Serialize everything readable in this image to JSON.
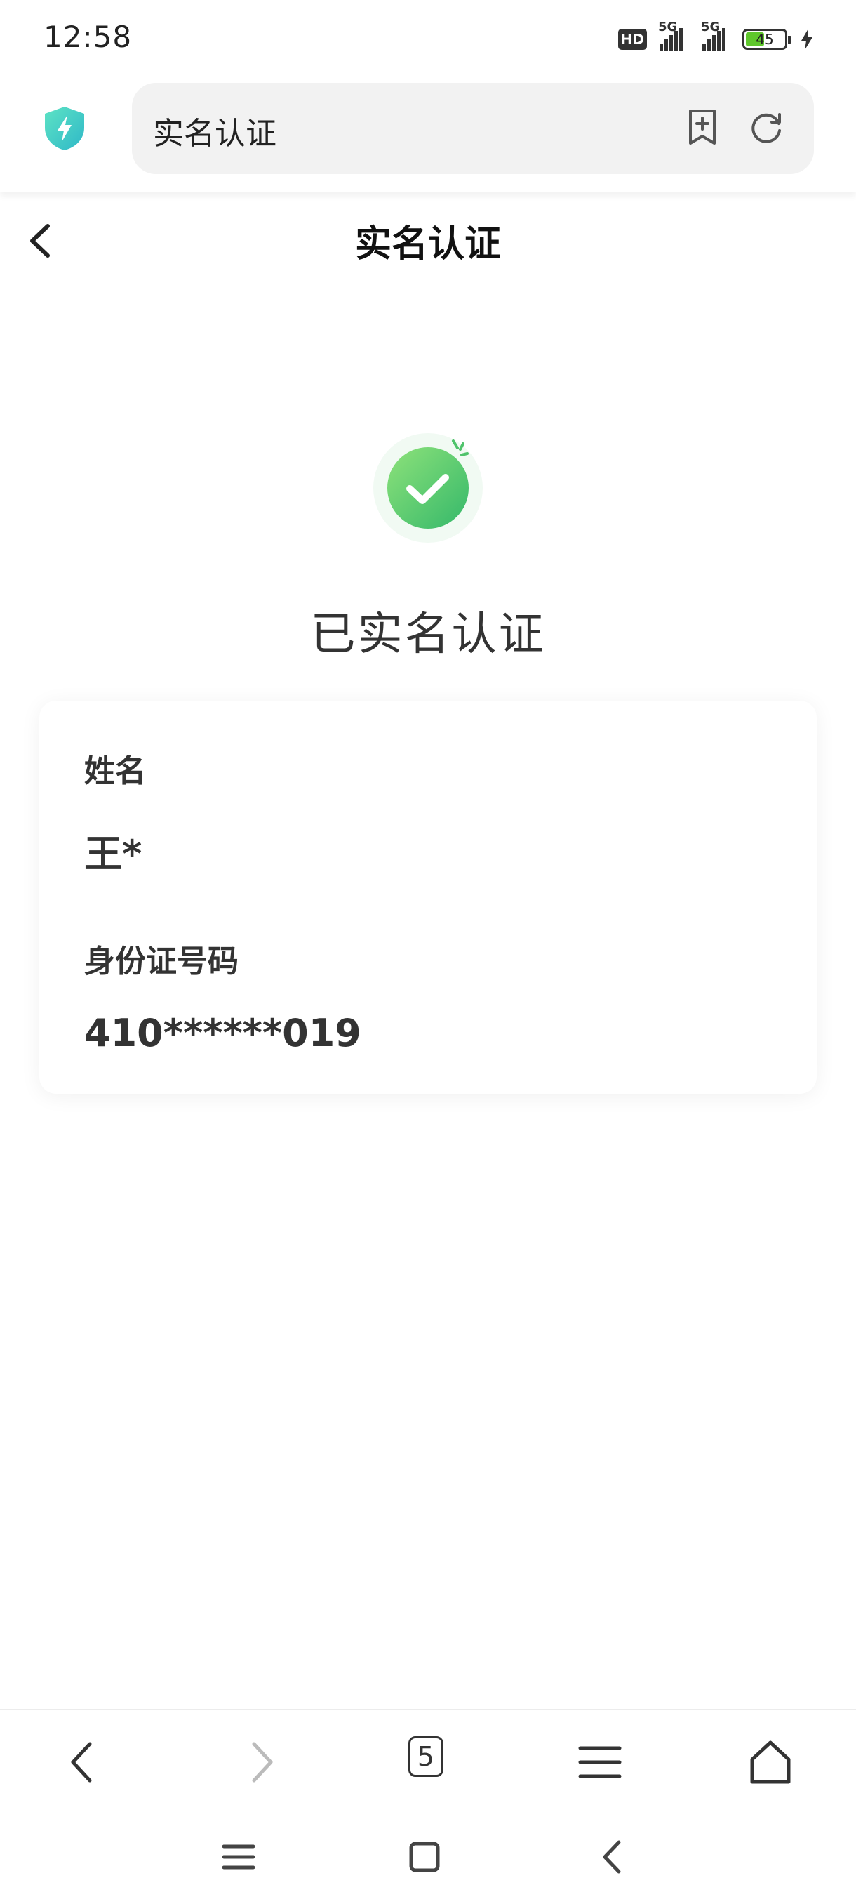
{
  "status_bar": {
    "time": "12:58",
    "hd_label": "HD",
    "network_label_1": "5G",
    "network_label_2": "5G",
    "battery_level": "45",
    "charging_icon": "lightning-icon"
  },
  "browser": {
    "url_title": "实名认证",
    "security_icon": "shield-lightning-icon",
    "bookmark_icon": "bookmark-add-icon",
    "refresh_icon": "refresh-icon",
    "tab_count": "5"
  },
  "page": {
    "title": "实名认证",
    "status_text": "已实名认证",
    "accent_color": "#4fc36b"
  },
  "card": {
    "name_label": "姓名",
    "name_value": "王*",
    "id_label": "身份证号码",
    "id_value": "410******019"
  }
}
